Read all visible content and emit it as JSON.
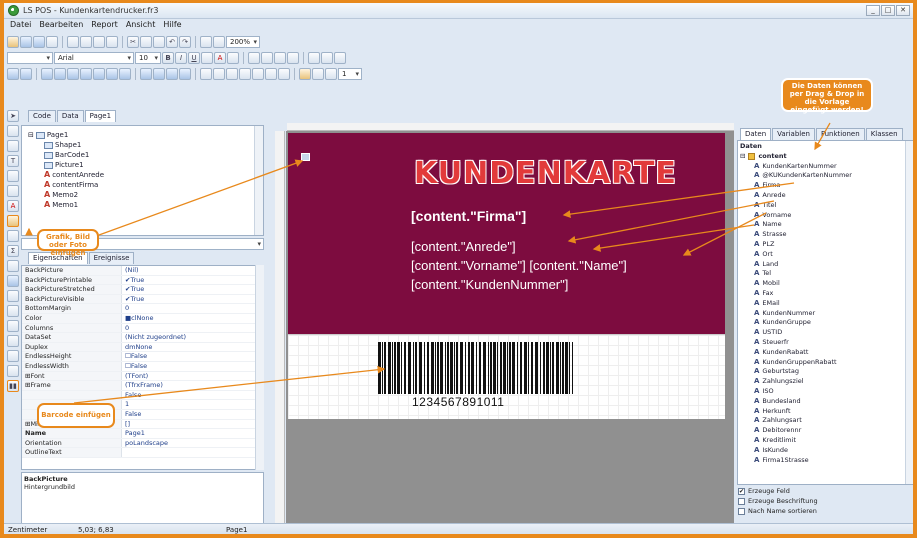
{
  "window": {
    "title": "LS POS  -  Kundenkartendrucker.fr3",
    "controls": [
      "_",
      "□",
      "✕"
    ]
  },
  "menu": [
    "Datei",
    "Bearbeiten",
    "Report",
    "Ansicht",
    "Hilfe"
  ],
  "toolbar": {
    "zoom": "200%",
    "font": "Arial",
    "font_size": "10"
  },
  "designer_tabs": [
    "Code",
    "Data",
    "Page1"
  ],
  "object_tree": {
    "root": "Page1",
    "items": [
      "Shape1",
      "BarCode1",
      "Picture1",
      "contentAnrede",
      "contentFirma",
      "Memo2",
      "Memo1"
    ]
  },
  "inspector_tabs": [
    "Eigenschaften",
    "Ereignisse"
  ],
  "properties": [
    {
      "k": "BackPicture",
      "v": "(Nil)"
    },
    {
      "k": "BackPicturePrintable",
      "v": "✔True"
    },
    {
      "k": "BackPictureStretched",
      "v": "✔True"
    },
    {
      "k": "BackPictureVisible",
      "v": "✔True"
    },
    {
      "k": "BottomMargin",
      "v": "0"
    },
    {
      "k": "Color",
      "v": "■clNone"
    },
    {
      "k": "Columns",
      "v": "0"
    },
    {
      "k": "DataSet",
      "v": "(Nicht zugeordnet)"
    },
    {
      "k": "Duplex",
      "v": "dmNone"
    },
    {
      "k": "EndlessHeight",
      "v": "☐False"
    },
    {
      "k": "EndlessWidth",
      "v": "☐False"
    },
    {
      "k": "⊞Font",
      "v": "(TFont)"
    },
    {
      "k": "⊞Frame",
      "v": "(TfrxFrame)"
    },
    {
      "k": "",
      "v": "False"
    },
    {
      "k": "",
      "v": "1"
    },
    {
      "k": "",
      "v": "False"
    },
    {
      "k": "⊞MirrorMode",
      "v": "[]"
    },
    {
      "k": "Name",
      "v": "Page1"
    },
    {
      "k": "Orientation",
      "v": "poLandscape"
    },
    {
      "k": "OutlineText",
      "v": ""
    }
  ],
  "description": {
    "title": "BackPicture",
    "text": "Hintergrundbild"
  },
  "card": {
    "heading": "KUNDENKARTE",
    "firma": "[content.\"Firma\"]",
    "anrede": "[content.\"Anrede\"]",
    "name_line": "[content.\"Vorname\"] [content.\"Name\"]",
    "kundennummer": "[content.\"KundenNummer\"]",
    "barcode_number": "1234567891011"
  },
  "right_tabs": [
    "Daten",
    "Variablen",
    "Funktionen",
    "Klassen"
  ],
  "data_tree": {
    "root": "Daten",
    "dataset": "content",
    "fields": [
      "KundenKartenNummer",
      "@KUKundenKartenNummer",
      "Firma",
      "Anrede",
      "Titel",
      "Vorname",
      "Name",
      "Strasse",
      "PLZ",
      "Ort",
      "Land",
      "Tel",
      "Mobil",
      "Fax",
      "EMail",
      "KundenNummer",
      "KundenGruppe",
      "USTID",
      "Steuerfr",
      "KundenRabatt",
      "KundenGruppenRabatt",
      "Geburtstag",
      "Zahlungsziel",
      "ISO",
      "Bundesland",
      "Herkunft",
      "Zahlungsart",
      "Debitorennr",
      "Kreditlimit",
      "IsKunde",
      "Firma1Strasse"
    ]
  },
  "options": [
    {
      "label": "Erzeuge Feld",
      "checked": true
    },
    {
      "label": "Erzeuge Beschriftung",
      "checked": false
    },
    {
      "label": "Nach Name sortieren",
      "checked": false
    }
  ],
  "status": {
    "unit": "Zentimeter",
    "coords": "5,03; 6,83",
    "page": "Page1"
  },
  "callouts": {
    "drag": "Die Daten können per Drag & Drop in die Vorlage eingefügt werden!",
    "image": "Grafik, Bild oder Foto einfügen",
    "barcode": "Barcode einfügen"
  },
  "colors": {
    "accent": "#e8891c",
    "card": "#7d0c3f",
    "heading": "#e23a3a"
  }
}
